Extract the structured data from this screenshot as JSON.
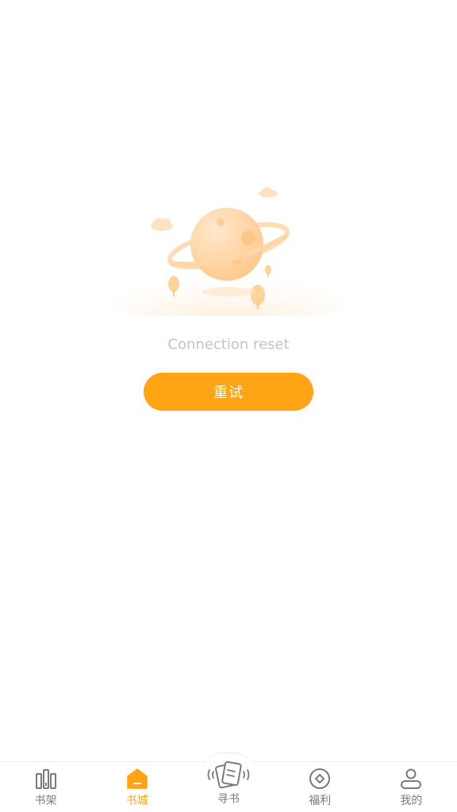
{
  "error": {
    "message": "Connection reset",
    "retry_label": "重试"
  },
  "tabbar": {
    "items": [
      {
        "label": "书架",
        "icon": "bookshelf-icon",
        "active": false
      },
      {
        "label": "书城",
        "icon": "bookstore-home-icon",
        "active": true
      },
      {
        "label": "寻书",
        "icon": "find-book-cards-icon",
        "active": false
      },
      {
        "label": "福利",
        "icon": "coin-welfare-icon",
        "active": false
      },
      {
        "label": "我的",
        "icon": "profile-person-icon",
        "active": false
      }
    ]
  },
  "colors": {
    "accent": "#ffa415",
    "tab_inactive": "#7a7a7a",
    "error_text": "#c4c4c4"
  }
}
